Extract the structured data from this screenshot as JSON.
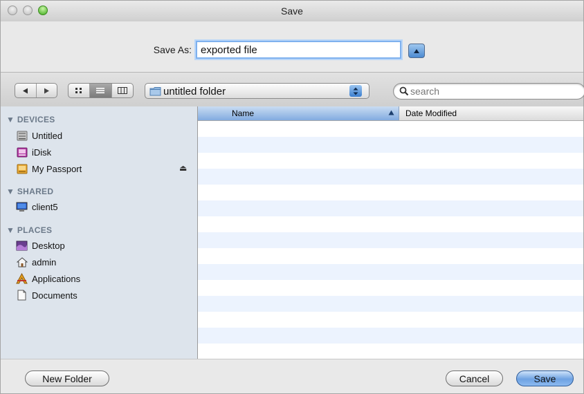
{
  "window": {
    "title": "Save"
  },
  "save_as": {
    "label": "Save As:",
    "value": "exported file"
  },
  "toolbar": {
    "location": "untitled folder",
    "search_placeholder": "search"
  },
  "sidebar": {
    "devices": {
      "header": "DEVICES",
      "items": [
        {
          "label": "Untitled",
          "icon": "hard-drive-icon"
        },
        {
          "label": "iDisk",
          "icon": "idisk-icon"
        },
        {
          "label": "My Passport",
          "icon": "external-drive-icon",
          "ejectable": true
        }
      ]
    },
    "shared": {
      "header": "SHARED",
      "items": [
        {
          "label": "client5",
          "icon": "computer-icon"
        }
      ]
    },
    "places": {
      "header": "PLACES",
      "items": [
        {
          "label": "Desktop",
          "icon": "desktop-icon"
        },
        {
          "label": "admin",
          "icon": "home-icon"
        },
        {
          "label": "Applications",
          "icon": "applications-icon"
        },
        {
          "label": "Documents",
          "icon": "documents-icon"
        }
      ]
    }
  },
  "file_list": {
    "columns": [
      {
        "label": "Name",
        "sorted": "ascending"
      },
      {
        "label": "Date Modified"
      }
    ],
    "rows": []
  },
  "buttons": {
    "new_folder": "New Folder",
    "cancel": "Cancel",
    "save": "Save"
  },
  "colors": {
    "accent": "#6ea2e2",
    "sidebar_bg": "#dde4ec",
    "row_stripe": "#ecf3fe"
  }
}
